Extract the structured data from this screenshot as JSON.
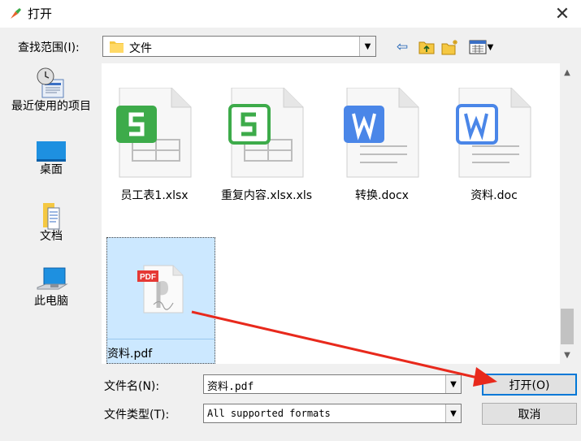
{
  "window": {
    "title": "打开",
    "close_glyph": "✕"
  },
  "toolbar": {
    "lookin_label": "查找范围(I):",
    "lookin_value": "文件",
    "back_glyph": "⇦"
  },
  "places": [
    {
      "label": "最近使用的项目",
      "icon": "recent-places-icon"
    },
    {
      "label": "桌面",
      "icon": "desktop-icon"
    },
    {
      "label": "文档",
      "icon": "documents-icon"
    },
    {
      "label": "此电脑",
      "icon": "computer-icon"
    }
  ],
  "files": [
    {
      "name": "员工表1.xlsx",
      "icon": "spreadsheet-icon",
      "accent": "#3dab4a"
    },
    {
      "name": "重复内容.xlsx.xls",
      "icon": "spreadsheet-outline-icon",
      "accent": "#3dab4a"
    },
    {
      "name": "转换.docx",
      "icon": "word-doc-icon",
      "accent": "#4a86e8"
    },
    {
      "name": "资料.doc",
      "icon": "word-doc-outline-icon",
      "accent": "#4a86e8"
    },
    {
      "name": "资料.pdf",
      "icon": "pdf-icon",
      "accent": "#e53935",
      "selected": true,
      "badge": "PDF"
    }
  ],
  "footer": {
    "filename_label": "文件名(N):",
    "filename_value": "资料.pdf",
    "filetype_label": "文件类型(T):",
    "filetype_value": "All supported formats",
    "open_label": "打开(O)",
    "cancel_label": "取消"
  },
  "colors": {
    "selection": "#cce8ff",
    "default_button_border": "#0078d7",
    "annotation_arrow": "#e8291c"
  }
}
